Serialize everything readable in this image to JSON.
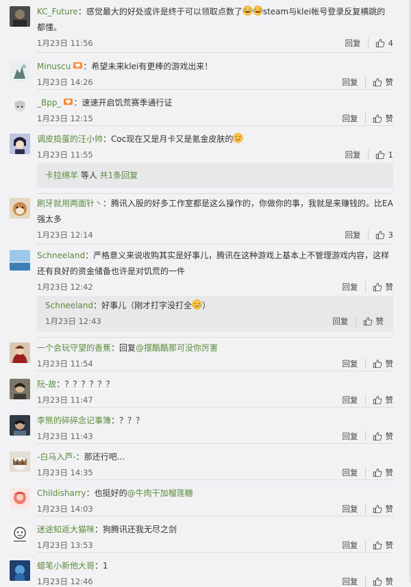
{
  "reply_label": "回复",
  "like_label": "赞",
  "comments": [
    {
      "user": "KC_Future",
      "sep": "：",
      "text_a": "感觉最大的好处或许是终于可以领取点数了",
      "emoji": [
        "laugh",
        "laugh"
      ],
      "text_b": "steam与klei帐号登录反复横跳的都懂。",
      "time": "1月23日 11:56",
      "likes": "4"
    },
    {
      "user": "Minuscu",
      "badge": "heart-badge",
      "sep": "：",
      "text_a": "希望未来klei有更棒的游戏出来！",
      "time": "1月23日 14:26",
      "likes": "赞"
    },
    {
      "user": "_Bpp_",
      "badge": "heart-badge",
      "sep": "：",
      "text_a": "速速开启饥荒赛季通行证",
      "time": "1月23日 12:15",
      "likes": "赞"
    },
    {
      "user": "调皮捣蛋的汪小帅",
      "sep": "：",
      "text_a": "Coc现在又是月卡又是氪金皮肤的",
      "emoji": [
        "smirk"
      ],
      "time": "1月23日 11:55",
      "likes": "1",
      "sub": {
        "user": "卡拉绵羊",
        "mid": " 等人 ",
        "count": "共1条回复"
      }
    },
    {
      "user": "刷牙就用两面针丶",
      "sep": "：",
      "text_a": "腾讯入股的好多工作室都是这么操作的，你做你的事，我就是来赚钱的。比EA强太多",
      "time": "1月23日 12:14",
      "likes": "3"
    },
    {
      "user": "Schneeland",
      "sep": "：",
      "text_a": "严格意义来说收购其实是好事儿，腾讯在这种游戏上基本上不管理游戏内容，这样还有良好的资金储备也许是对饥荒的一件",
      "time": "1月23日 12:42",
      "likes": "赞",
      "reply": {
        "user": "Schneeland",
        "sep": "：",
        "text": "好事儿（刚才打字没打全",
        "emoji": "cry",
        "tail": "）",
        "time": "1月23日 12:43",
        "likes": "赞"
      }
    },
    {
      "user": "一个会玩守望的香蕉",
      "sep": "：",
      "text_a": "回复",
      "mention": "@摆酷酷那可没你厉害",
      "time": "1月23日 11:54",
      "likes": "赞"
    },
    {
      "user": "阮-故",
      "sep": "：",
      "text_a": "？？？？？？",
      "time": "1月23日 11:47",
      "likes": "赞"
    },
    {
      "user": "李熊的碎碎念记事簿",
      "sep": "：",
      "text_a": "？？？",
      "time": "1月23日 11:43",
      "likes": "赞"
    },
    {
      "user": "-白马入芦-",
      "sep": "：",
      "text_a": "那还行吧...",
      "time": "1月23日 14:35",
      "likes": "赞"
    },
    {
      "user": "Childisharry",
      "sep": "：",
      "text_a": "也挺好的",
      "mention": "@牛肉干加榴莲糖",
      "time": "1月23日 14:03",
      "likes": "赞"
    },
    {
      "user": "迷途知返大猫咪",
      "sep": "：",
      "text_a": "狗腾讯还我无尽之剑",
      "time": "1月23日 13:53",
      "likes": "赞"
    },
    {
      "user": "蜡笔小新他大哥",
      "sep": "：",
      "text_a": "1",
      "time": "1月23日 12:46",
      "likes": "赞"
    }
  ],
  "colors": {
    "username": "#5a8b3a",
    "background": "#f2f2f5",
    "text": "#333333"
  }
}
